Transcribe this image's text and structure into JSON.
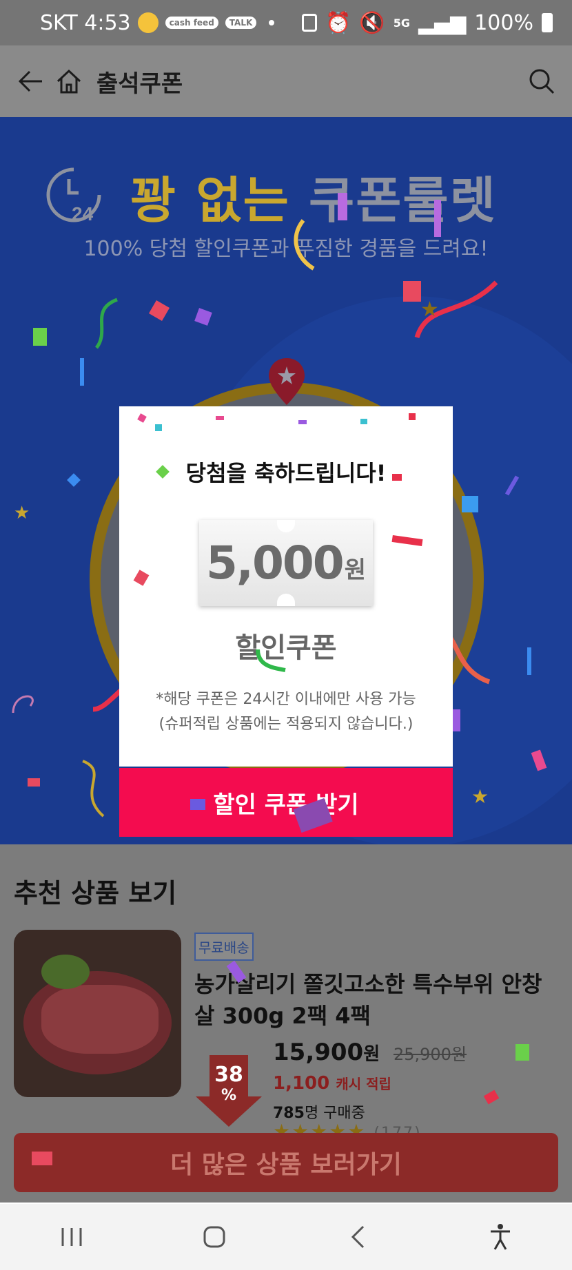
{
  "status_bar": {
    "carrier_time": "SKT 4:53",
    "icon_cashfeed": "cash feed",
    "icon_talk": "TALK",
    "network": "5G",
    "battery": "100%"
  },
  "header": {
    "title": "출석쿠폰"
  },
  "banner": {
    "clock_number": "24",
    "title_gold": "꽝 없는",
    "title_gray": "쿠폰룰렛",
    "subtitle": "100% 당첨 할인쿠폰과 푸짐한 경품을 드려요!"
  },
  "modal": {
    "title": "당첨을 축하드립니다!",
    "amount": "5,000",
    "unit": "원",
    "coupon_label": "할인쿠폰",
    "notice_line1": "*해당 쿠폰은 24시간 이내에만 사용 가능",
    "notice_line2": "(슈퍼적립 상품에는 적용되지 않습니다.)",
    "button": "할인 쿠폰 받기"
  },
  "recommend": {
    "title": "추천 상품 보기",
    "product": {
      "badge": "무료배송",
      "name": "농가살리기 쫄깃고소한 특수부위 안창살 300g 2팩 4팩",
      "discount": "38",
      "discount_unit": "%",
      "price": "15,900",
      "price_unit": "원",
      "original_price": "25,900",
      "original_unit": "원",
      "cashback": "1,100",
      "cashback_label": "캐시 적립",
      "buyers": "785",
      "buyers_label": "명 구매중",
      "stars": "★★★★★",
      "review_count": "(177)"
    },
    "more_button": "더 많은 상품 보러가기"
  },
  "colors": {
    "banner_bg": "#1a3a8e",
    "gold": "#c9a72f",
    "cta_red": "#f40c4f"
  }
}
